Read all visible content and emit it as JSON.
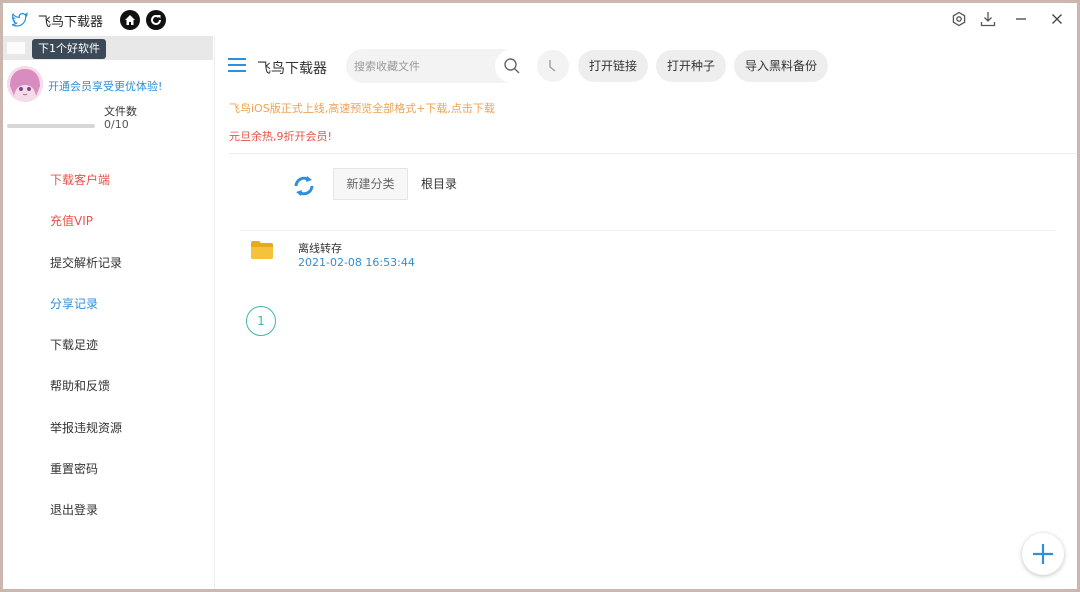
{
  "app": {
    "title": "飞鸟下载器",
    "colors": {
      "accent": "#2f8fd8",
      "danger": "#e8534a",
      "notice": "#f1a153",
      "pager": "#3fb7a9"
    }
  },
  "titlebar": {
    "icons": [
      "bird-logo-icon",
      "home-icon",
      "refresh-icon",
      "settings-icon",
      "download-icon",
      "minimize-icon",
      "close-icon"
    ]
  },
  "sidebar": {
    "tooltip": "下1个好软件",
    "vip_link": "开通会员享受更优体验!",
    "files_label": "文件数",
    "files_count": "0/10",
    "files_progress": 0,
    "items": [
      {
        "label": "下载客户端"
      },
      {
        "label": "充值VIP"
      },
      {
        "label": "提交解析记录"
      },
      {
        "label": "分享记录"
      },
      {
        "label": "下载足迹"
      },
      {
        "label": "帮助和反馈"
      },
      {
        "label": "举报违规资源"
      },
      {
        "label": "重置密码"
      },
      {
        "label": "退出登录"
      }
    ]
  },
  "header": {
    "title": "飞鸟下载器",
    "search_placeholder": "搜索收藏文件",
    "buttons": {
      "open_link": "打开链接",
      "open_torrent": "打开种子",
      "import_backup": "导入黑料备份"
    }
  },
  "notices": {
    "ios": "飞鸟iOS版正式上线,高速预览全部格式+下载,点击下载",
    "promo": "元旦余热,9折开会员!"
  },
  "toolbar": {
    "new_category": "新建分类",
    "root_dir": "根目录"
  },
  "files": [
    {
      "name": "离线转存",
      "date": "2021-02-08 16:53:44"
    }
  ],
  "pagination": {
    "current": "1"
  }
}
